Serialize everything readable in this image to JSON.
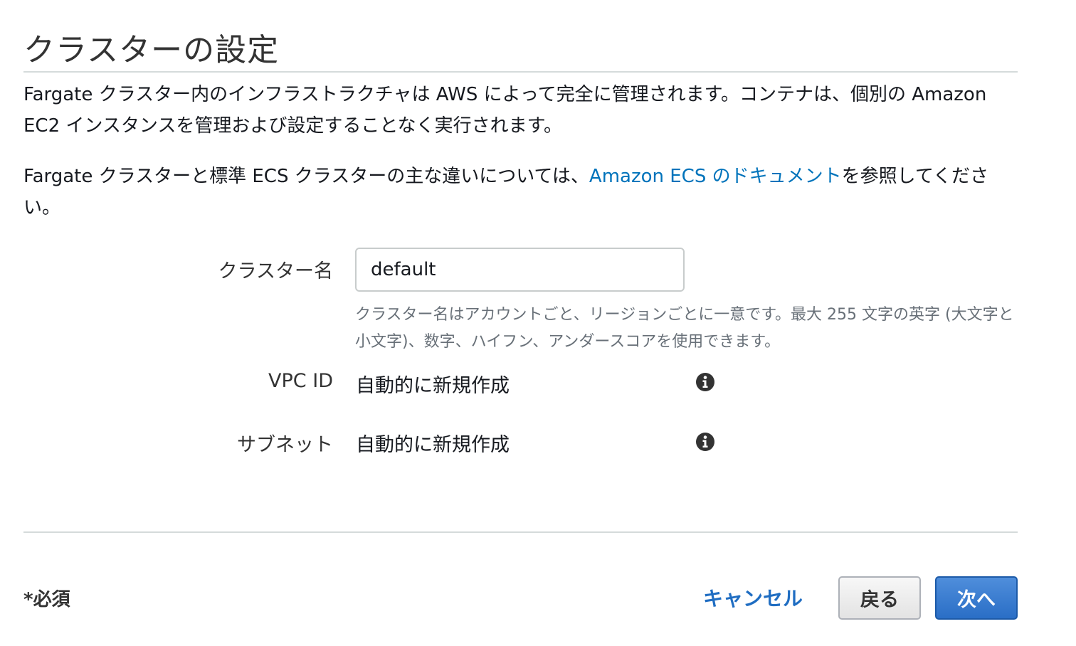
{
  "header": {
    "title": "クラスターの設定"
  },
  "description": {
    "paragraph1": "Fargate クラスター内のインフラストラクチャは AWS によって完全に管理されます。コンテナは、個別の Amazon EC2 インスタンスを管理および設定することなく実行されます。",
    "paragraph2_before": "Fargate クラスターと標準 ECS クラスターの主な違いについては、",
    "paragraph2_link": "Amazon ECS のドキュメント",
    "paragraph2_after": "を参照してください。"
  },
  "form": {
    "cluster_name": {
      "label": "クラスター名",
      "value": "default",
      "hint": "クラスター名はアカウントごと、リージョンごとに一意です。最大 255 文字の英字 (大文字と小文字)、数字、ハイフン、アンダースコアを使用できます。"
    },
    "vpc": {
      "label": "VPC ID",
      "value": "自動的に新規作成",
      "icon": "info-icon"
    },
    "subnet": {
      "label": "サブネット",
      "value": "自動的に新規作成",
      "icon": "info-icon"
    }
  },
  "footer": {
    "required_note": "*必須",
    "cancel_label": "キャンセル",
    "back_label": "戻る",
    "next_label": "次へ"
  },
  "colors": {
    "link": "#0073bb",
    "primary_button": "#2a6ec6",
    "divider": "#d5dbdb"
  }
}
